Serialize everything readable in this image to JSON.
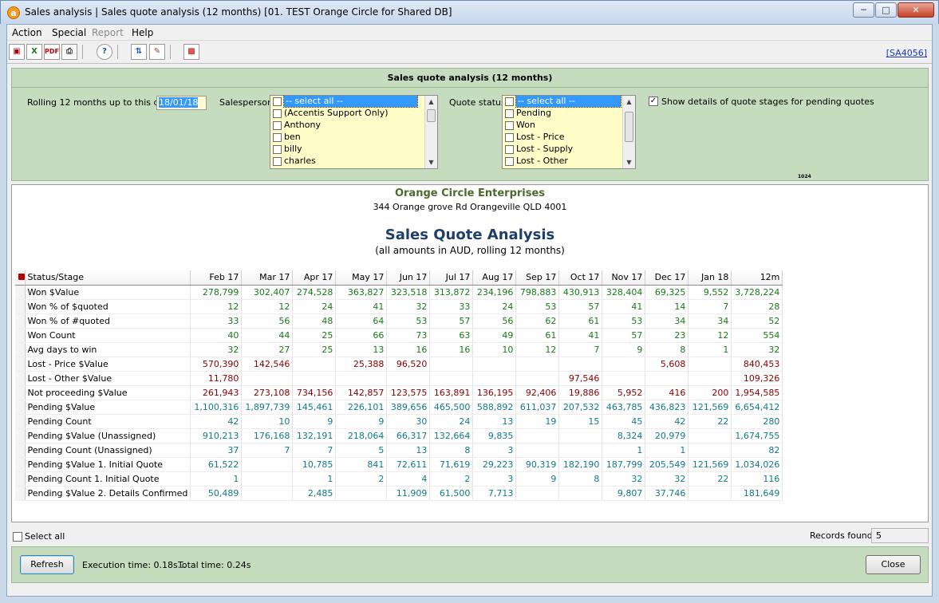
{
  "window": {
    "title": "Sales analysis | Sales quote analysis (12 months) [01. TEST Orange Circle for Shared DB]",
    "app_icon": "a",
    "controls": [
      "minimize-icon",
      "maximize-icon",
      "close-icon"
    ]
  },
  "menu": [
    "Action",
    "Special",
    "Report",
    "Help"
  ],
  "toolbar": {
    "buttons": [
      "save-icon",
      "excel-icon",
      "pdf-icon",
      "print-icon",
      "help-icon",
      "refresh-layout-icon",
      "edit-icon",
      "chart-icon"
    ],
    "screen_code": "[SA4056]"
  },
  "filters": {
    "heading": "Sales quote analysis (12 months)",
    "rolling_label": "Rolling 12 months up to this date:",
    "rolling_value": "18/01/18",
    "salesperson_label": "Salesperson:",
    "salesperson_items": [
      "-- select all --",
      "(Accentis Support Only)",
      "Anthony",
      "ben",
      "billy",
      "charles"
    ],
    "quote_status_label": "Quote status:",
    "quote_status_items": [
      "-- select all --",
      "Pending",
      "Won",
      "Lost - Price",
      "Lost - Supply",
      "Lost - Other"
    ],
    "show_details_label": "Show details of quote stages for pending quotes",
    "show_details_checked": true,
    "tiny_label": "1024"
  },
  "report": {
    "company": "Orange Circle Enterprises",
    "address": "344 Orange grove Rd  Orangeville QLD 4001",
    "title": "Sales Quote Analysis",
    "subtitle": "(all amounts in AUD, rolling 12 months)",
    "columns": [
      "Status/Stage",
      "Feb 17",
      "Mar 17",
      "Apr 17",
      "May 17",
      "Jun 17",
      "Jul 17",
      "Aug 17",
      "Sep 17",
      "Oct 17",
      "Nov 17",
      "Dec 17",
      "Jan 18",
      "12m"
    ],
    "rows": [
      {
        "label": "Won $Value",
        "color": "green",
        "values": [
          "278,799",
          "302,407",
          "274,528",
          "363,827",
          "323,518",
          "313,872",
          "234,196",
          "798,883",
          "430,913",
          "328,404",
          "69,325",
          "9,552",
          "3,728,224"
        ]
      },
      {
        "label": "Won % of $quoted",
        "color": "green",
        "values": [
          "12",
          "12",
          "24",
          "41",
          "32",
          "33",
          "24",
          "53",
          "57",
          "41",
          "14",
          "7",
          "28"
        ]
      },
      {
        "label": "Won % of #quoted",
        "color": "green",
        "values": [
          "33",
          "56",
          "48",
          "64",
          "53",
          "57",
          "56",
          "62",
          "61",
          "53",
          "34",
          "34",
          "52"
        ]
      },
      {
        "label": "Won Count",
        "color": "green",
        "values": [
          "40",
          "44",
          "25",
          "66",
          "73",
          "63",
          "49",
          "61",
          "41",
          "57",
          "23",
          "12",
          "554"
        ]
      },
      {
        "label": "Avg days to win",
        "color": "green",
        "values": [
          "32",
          "27",
          "25",
          "13",
          "16",
          "16",
          "10",
          "12",
          "7",
          "9",
          "8",
          "1",
          "32"
        ]
      },
      {
        "label": "Lost - Price $Value",
        "color": "red",
        "values": [
          "570,390",
          "142,546",
          "",
          "25,388",
          "96,520",
          "",
          "",
          "",
          "",
          "",
          "5,608",
          "",
          "840,453"
        ]
      },
      {
        "label": "Lost - Other $Value",
        "color": "red",
        "values": [
          "11,780",
          "",
          "",
          "",
          "",
          "",
          "",
          "",
          "97,546",
          "",
          "",
          "",
          "109,326"
        ]
      },
      {
        "label": "Not proceeding $Value",
        "color": "red",
        "values": [
          "261,943",
          "273,108",
          "734,156",
          "142,857",
          "123,575",
          "163,891",
          "136,195",
          "92,406",
          "19,886",
          "5,952",
          "416",
          "200",
          "1,954,585"
        ]
      },
      {
        "label": "Pending $Value",
        "color": "teal",
        "values": [
          "1,100,316",
          "1,897,739",
          "145,461",
          "226,101",
          "389,656",
          "465,500",
          "588,892",
          "611,037",
          "207,532",
          "463,785",
          "436,823",
          "121,569",
          "6,654,412"
        ]
      },
      {
        "label": "Pending Count",
        "color": "teal",
        "values": [
          "42",
          "10",
          "9",
          "9",
          "30",
          "24",
          "13",
          "19",
          "15",
          "45",
          "42",
          "22",
          "280"
        ]
      },
      {
        "label": "Pending $Value (Unassigned)",
        "color": "teal",
        "values": [
          "910,213",
          "176,168",
          "132,191",
          "218,064",
          "66,317",
          "132,664",
          "9,835",
          "",
          "",
          "8,324",
          "20,979",
          "",
          "1,674,755"
        ]
      },
      {
        "label": "Pending Count (Unassigned)",
        "color": "teal",
        "values": [
          "37",
          "7",
          "7",
          "5",
          "13",
          "8",
          "3",
          "",
          "",
          "1",
          "1",
          "",
          "82"
        ]
      },
      {
        "label": "Pending $Value 1. Initial Quote",
        "color": "teal",
        "values": [
          "61,522",
          "",
          "10,785",
          "841",
          "72,611",
          "71,619",
          "29,223",
          "90,319",
          "182,190",
          "187,799",
          "205,549",
          "121,569",
          "1,034,026"
        ]
      },
      {
        "label": "Pending Count 1. Initial Quote",
        "color": "teal",
        "values": [
          "1",
          "",
          "1",
          "2",
          "4",
          "2",
          "3",
          "9",
          "8",
          "32",
          "32",
          "22",
          "116"
        ]
      },
      {
        "label": "Pending $Value 2. Details Confirmed",
        "color": "teal",
        "values": [
          "50,489",
          "",
          "2,485",
          "",
          "11,909",
          "61,500",
          "7,713",
          "",
          "",
          "9,807",
          "37,746",
          "",
          "181,649"
        ]
      }
    ]
  },
  "footer": {
    "select_all_label": "Select all",
    "records_found_label": "Records found:",
    "records_found_value": "5",
    "refresh_label": "Refresh",
    "execution_time": "Execution time: 0.18s...",
    "total_time": "Total time: 0.24s",
    "close_label": "Close"
  },
  "colors": {
    "green": "#1b7a1b",
    "red": "#8b0000",
    "teal": "#127a8a",
    "panel": "#c5dcbe",
    "listbox": "#fffcc8",
    "company": "#4a6b2a",
    "report_title": "#1f3f6a"
  }
}
